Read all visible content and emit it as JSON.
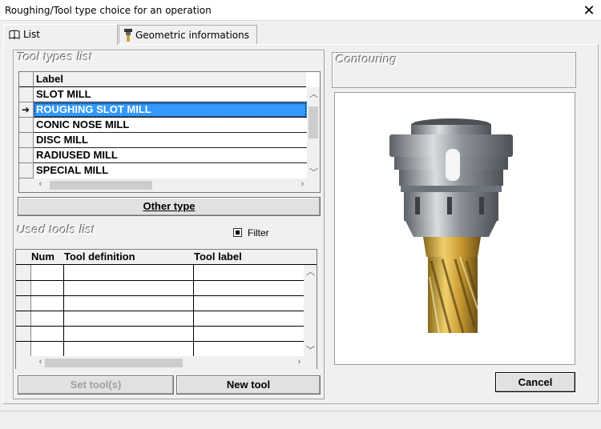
{
  "window": {
    "title": "Roughing/Tool type choice for an operation"
  },
  "tabs": [
    {
      "label": "List"
    },
    {
      "label": "Geometric informations"
    }
  ],
  "tool_types": {
    "group_label": "Tool types list",
    "column_header": "Label",
    "items": [
      "SLOT MILL",
      "ROUGHING SLOT MILL",
      "CONIC NOSE MILL",
      "DISC MILL",
      "RADIUSED MILL",
      "SPECIAL MILL"
    ],
    "selected_index": 1,
    "other_type_button": "Other type"
  },
  "used_tools": {
    "group_label": "Used tools list",
    "filter_label": "Filter",
    "columns": [
      "Num",
      "Tool definition",
      "Tool label"
    ],
    "rows": 6
  },
  "buttons": {
    "set_tools": "Set tool(s)",
    "new_tool": "New tool",
    "cancel": "Cancel"
  },
  "preview": {
    "title": "Contouring"
  },
  "colors": {
    "selection": "#3399ff",
    "tool_gold": "#d4a93c",
    "holder_gray": "#8a9096"
  },
  "icons": [
    "book-icon",
    "tool-icon",
    "close-icon",
    "row-pointer-icon"
  ]
}
